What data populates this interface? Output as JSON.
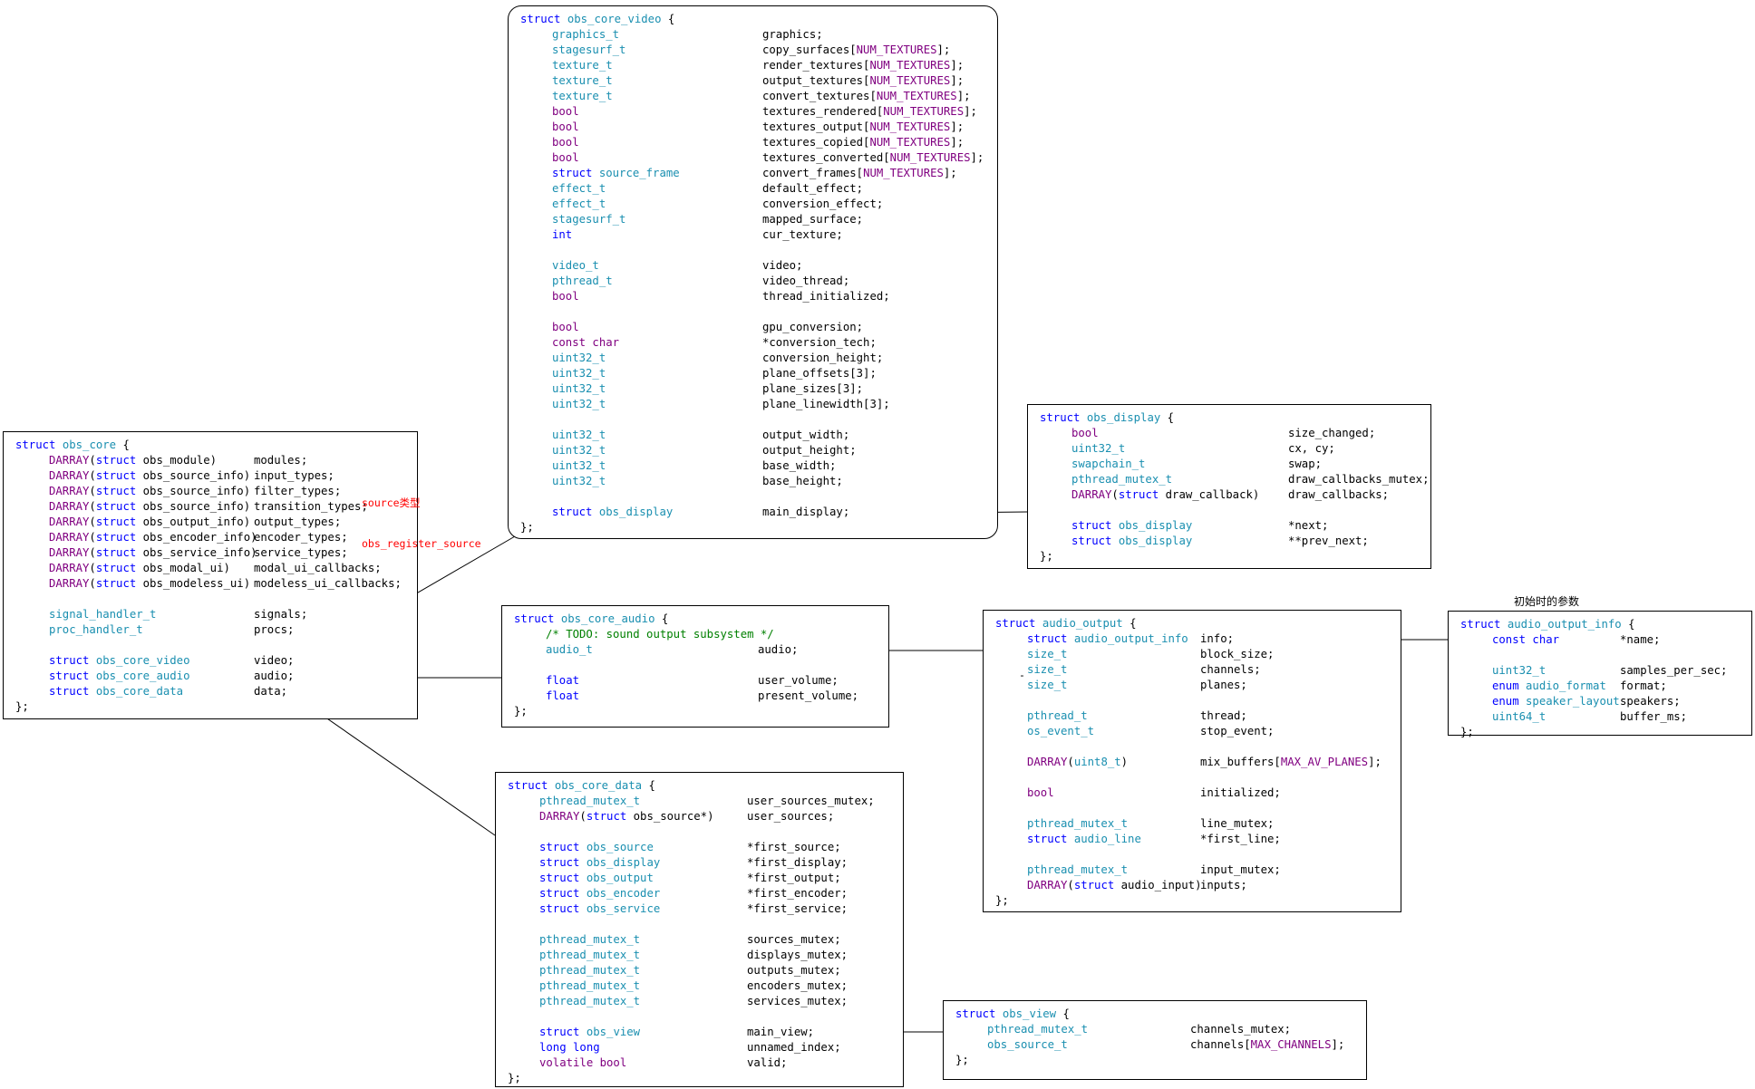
{
  "boxes": [
    {
      "id": "obs-core",
      "title": "obs_core",
      "lines": [
        [
          {
            "t": "DARRAY",
            "c": "mc"
          },
          {
            "t": "(",
            "c": "bk"
          },
          {
            "t": "struct",
            "c": "kw"
          },
          {
            "t": " obs_module)",
            "c": "bk"
          },
          {
            "n": "modules;"
          }
        ],
        [
          {
            "t": "DARRAY",
            "c": "mc"
          },
          {
            "t": "(",
            "c": "bk"
          },
          {
            "t": "struct",
            "c": "kw"
          },
          {
            "t": " obs_source_info)",
            "c": "bk"
          },
          {
            "n": "input_types;"
          }
        ],
        [
          {
            "t": "DARRAY",
            "c": "mc"
          },
          {
            "t": "(",
            "c": "bk"
          },
          {
            "t": "struct",
            "c": "kw"
          },
          {
            "t": " obs_source_info)",
            "c": "bk"
          },
          {
            "n": "filter_types;"
          }
        ],
        [
          {
            "t": "DARRAY",
            "c": "mc"
          },
          {
            "t": "(",
            "c": "bk"
          },
          {
            "t": "struct",
            "c": "kw"
          },
          {
            "t": " obs_source_info)",
            "c": "bk"
          },
          {
            "n": "transition_types;"
          }
        ],
        [
          {
            "t": "DARRAY",
            "c": "mc"
          },
          {
            "t": "(",
            "c": "bk"
          },
          {
            "t": "struct",
            "c": "kw"
          },
          {
            "t": " obs_output_info)",
            "c": "bk"
          },
          {
            "n": "output_types;"
          }
        ],
        [
          {
            "t": "DARRAY",
            "c": "mc"
          },
          {
            "t": "(",
            "c": "bk"
          },
          {
            "t": "struct",
            "c": "kw"
          },
          {
            "t": " obs_encoder_info)",
            "c": "bk"
          },
          {
            "n": "encoder_types;"
          }
        ],
        [
          {
            "t": "DARRAY",
            "c": "mc"
          },
          {
            "t": "(",
            "c": "bk"
          },
          {
            "t": "struct",
            "c": "kw"
          },
          {
            "t": " obs_service_info)",
            "c": "bk"
          },
          {
            "n": "service_types;"
          }
        ],
        [
          {
            "t": "DARRAY",
            "c": "mc"
          },
          {
            "t": "(",
            "c": "bk"
          },
          {
            "t": "struct",
            "c": "kw"
          },
          {
            "t": " obs_modal_ui)",
            "c": "bk"
          },
          {
            "n": "modal_ui_callbacks;"
          }
        ],
        [
          {
            "t": "DARRAY",
            "c": "mc"
          },
          {
            "t": "(",
            "c": "bk"
          },
          {
            "t": "struct",
            "c": "kw"
          },
          {
            "t": " obs_modeless_ui)",
            "c": "bk"
          },
          {
            "n": "modeless_ui_callbacks;"
          }
        ],
        [],
        [
          {
            "t": "signal_handler_t",
            "c": "tn"
          },
          {
            "n": "signals;"
          }
        ],
        [
          {
            "t": "proc_handler_t",
            "c": "tn"
          },
          {
            "n": "procs;"
          }
        ],
        [],
        [
          {
            "t": "struct",
            "c": "kw"
          },
          {
            "t": " obs_core_video",
            "c": "tn"
          },
          {
            "n": "video;"
          }
        ],
        [
          {
            "t": "struct",
            "c": "kw"
          },
          {
            "t": " obs_core_audio",
            "c": "tn"
          },
          {
            "n": "audio;"
          }
        ],
        [
          {
            "t": "struct",
            "c": "kw"
          },
          {
            "t": " obs_core_data",
            "c": "tn"
          },
          {
            "n": "data;"
          }
        ]
      ]
    },
    {
      "id": "obs-core-video",
      "title": "obs_core_video",
      "lines": [
        [
          {
            "t": "graphics_t",
            "c": "tn"
          },
          {
            "n": "graphics;"
          }
        ],
        [
          {
            "t": "stagesurf_t",
            "c": "tn"
          },
          {
            "n": "copy_surfaces[",
            "m": "NUM_TEXTURES",
            "e": "];"
          }
        ],
        [
          {
            "t": "texture_t",
            "c": "tn"
          },
          {
            "n": "render_textures[",
            "m": "NUM_TEXTURES",
            "e": "];"
          }
        ],
        [
          {
            "t": "texture_t",
            "c": "tn"
          },
          {
            "n": "output_textures[",
            "m": "NUM_TEXTURES",
            "e": "];"
          }
        ],
        [
          {
            "t": "texture_t",
            "c": "tn"
          },
          {
            "n": "convert_textures[",
            "m": "NUM_TEXTURES",
            "e": "];"
          }
        ],
        [
          {
            "t": "bool",
            "c": "mc"
          },
          {
            "n": "textures_rendered[",
            "m": "NUM_TEXTURES",
            "e": "];"
          }
        ],
        [
          {
            "t": "bool",
            "c": "mc"
          },
          {
            "n": "textures_output[",
            "m": "NUM_TEXTURES",
            "e": "];"
          }
        ],
        [
          {
            "t": "bool",
            "c": "mc"
          },
          {
            "n": "textures_copied[",
            "m": "NUM_TEXTURES",
            "e": "];"
          }
        ],
        [
          {
            "t": "bool",
            "c": "mc"
          },
          {
            "n": "textures_converted[",
            "m": "NUM_TEXTURES",
            "e": "];"
          }
        ],
        [
          {
            "t": "struct",
            "c": "kw"
          },
          {
            "t": " source_frame",
            "c": "tn"
          },
          {
            "n": "convert_frames[",
            "m": "NUM_TEXTURES",
            "e": "];"
          }
        ],
        [
          {
            "t": "effect_t",
            "c": "tn"
          },
          {
            "n": "default_effect;"
          }
        ],
        [
          {
            "t": "effect_t",
            "c": "tn"
          },
          {
            "n": "conversion_effect;"
          }
        ],
        [
          {
            "t": "stagesurf_t",
            "c": "tn"
          },
          {
            "n": "mapped_surface;"
          }
        ],
        [
          {
            "t": "int",
            "c": "kw"
          },
          {
            "n": "cur_texture;"
          }
        ],
        [],
        [
          {
            "t": "video_t",
            "c": "tn"
          },
          {
            "n": "video;"
          }
        ],
        [
          {
            "t": "pthread_t",
            "c": "tn"
          },
          {
            "n": "video_thread;"
          }
        ],
        [
          {
            "t": "bool",
            "c": "mc"
          },
          {
            "n": "thread_initialized;"
          }
        ],
        [],
        [
          {
            "t": "bool",
            "c": "mc"
          },
          {
            "n": "gpu_conversion;"
          }
        ],
        [
          {
            "t": "const char",
            "c": "mc"
          },
          {
            "n": "*conversion_tech;"
          }
        ],
        [
          {
            "t": "uint32_t",
            "c": "tn"
          },
          {
            "n": "conversion_height;"
          }
        ],
        [
          {
            "t": "uint32_t",
            "c": "tn"
          },
          {
            "n": "plane_offsets[3];"
          }
        ],
        [
          {
            "t": "uint32_t",
            "c": "tn"
          },
          {
            "n": "plane_sizes[3];"
          }
        ],
        [
          {
            "t": "uint32_t",
            "c": "tn"
          },
          {
            "n": "plane_linewidth[3];"
          }
        ],
        [],
        [
          {
            "t": "uint32_t",
            "c": "tn"
          },
          {
            "n": "output_width;"
          }
        ],
        [
          {
            "t": "uint32_t",
            "c": "tn"
          },
          {
            "n": "output_height;"
          }
        ],
        [
          {
            "t": "uint32_t",
            "c": "tn"
          },
          {
            "n": "base_width;"
          }
        ],
        [
          {
            "t": "uint32_t",
            "c": "tn"
          },
          {
            "n": "base_height;"
          }
        ],
        [],
        [
          {
            "t": "struct",
            "c": "kw"
          },
          {
            "t": " obs_display",
            "c": "tn"
          },
          {
            "n": "main_display;"
          }
        ]
      ]
    },
    {
      "id": "obs-display",
      "title": "obs_display",
      "lines": [
        [
          {
            "t": "bool",
            "c": "mc"
          },
          {
            "n": "size_changed;"
          }
        ],
        [
          {
            "t": "uint32_t",
            "c": "tn"
          },
          {
            "n": "cx, cy;"
          }
        ],
        [
          {
            "t": "swapchain_t",
            "c": "tn"
          },
          {
            "n": "swap;"
          }
        ],
        [
          {
            "t": "pthread_mutex_t",
            "c": "tn"
          },
          {
            "n": "draw_callbacks_mutex;"
          }
        ],
        [
          {
            "t": "DARRAY",
            "c": "mc"
          },
          {
            "t": "(",
            "c": "bk"
          },
          {
            "t": "struct",
            "c": "kw"
          },
          {
            "t": " draw_callback)",
            "c": "bk"
          },
          {
            "n": "draw_callbacks;"
          }
        ],
        [],
        [
          {
            "t": "struct",
            "c": "kw"
          },
          {
            "t": " obs_display",
            "c": "tn"
          },
          {
            "n": "*next;"
          }
        ],
        [
          {
            "t": "struct",
            "c": "kw"
          },
          {
            "t": " obs_display",
            "c": "tn"
          },
          {
            "n": "**prev_next;"
          }
        ]
      ]
    },
    {
      "id": "obs-core-audio",
      "title": "obs_core_audio",
      "lines": [
        [
          {
            "t": "/* TODO: sound output subsystem */",
            "c": "cm"
          }
        ],
        [
          {
            "t": "audio_t",
            "c": "tn"
          },
          {
            "n": "audio;"
          }
        ],
        [],
        [
          {
            "t": "float",
            "c": "kw"
          },
          {
            "n": "user_volume;"
          }
        ],
        [
          {
            "t": "float",
            "c": "kw"
          },
          {
            "n": "present_volume;"
          }
        ]
      ]
    },
    {
      "id": "audio-output",
      "title": "audio_output",
      "lines": [
        [
          {
            "t": "struct",
            "c": "kw"
          },
          {
            "t": " audio_output_info",
            "c": "tn"
          },
          {
            "n": "info;"
          }
        ],
        [
          {
            "t": "size_t",
            "c": "tn"
          },
          {
            "n": "block_size;"
          }
        ],
        [
          {
            "t": "size_t",
            "c": "tn"
          },
          {
            "n": "channels;"
          }
        ],
        [
          {
            "t": "size_t",
            "c": "tn"
          },
          {
            "n": "planes;"
          }
        ],
        [],
        [
          {
            "t": "pthread_t",
            "c": "tn"
          },
          {
            "n": "thread;"
          }
        ],
        [
          {
            "t": "os_event_t",
            "c": "tn"
          },
          {
            "n": "stop_event;"
          }
        ],
        [],
        [
          {
            "t": "DARRAY",
            "c": "mc"
          },
          {
            "t": "(",
            "c": "bk"
          },
          {
            "t": "uint8_t",
            "c": "tn"
          },
          {
            "t": ")",
            "c": "bk"
          },
          {
            "n": "mix_buffers[",
            "m": "MAX_AV_PLANES",
            "e": "];"
          }
        ],
        [],
        [
          {
            "t": "bool",
            "c": "mc"
          },
          {
            "n": "initialized;"
          }
        ],
        [],
        [
          {
            "t": "pthread_mutex_t",
            "c": "tn"
          },
          {
            "n": "line_mutex;"
          }
        ],
        [
          {
            "t": "struct",
            "c": "kw"
          },
          {
            "t": " audio_line",
            "c": "tn"
          },
          {
            "n": "*first_line;"
          }
        ],
        [],
        [
          {
            "t": "pthread_mutex_t",
            "c": "tn"
          },
          {
            "n": "input_mutex;"
          }
        ],
        [
          {
            "t": "DARRAY",
            "c": "mc"
          },
          {
            "t": "(",
            "c": "bk"
          },
          {
            "t": "struct",
            "c": "kw"
          },
          {
            "t": " audio_input)",
            "c": "bk"
          },
          {
            "n": "inputs;"
          }
        ]
      ]
    },
    {
      "id": "audio-output-info",
      "title": "audio_output_info",
      "lines": [
        [
          {
            "t": "const char",
            "c": "kw"
          },
          {
            "n": "*name;"
          }
        ],
        [],
        [
          {
            "t": "uint32_t",
            "c": "tn"
          },
          {
            "n": "samples_per_sec;"
          }
        ],
        [
          {
            "t": "enum",
            "c": "kw"
          },
          {
            "t": " audio_format",
            "c": "tn"
          },
          {
            "n": "format;"
          }
        ],
        [
          {
            "t": "enum",
            "c": "kw"
          },
          {
            "t": " speaker_layout",
            "c": "tn"
          },
          {
            "n": "speakers;"
          }
        ],
        [
          {
            "t": "uint64_t",
            "c": "tn"
          },
          {
            "n": "buffer_ms;"
          }
        ]
      ]
    },
    {
      "id": "obs-core-data",
      "title": "obs_core_data",
      "lines": [
        [
          {
            "t": "pthread_mutex_t",
            "c": "tn"
          },
          {
            "n": "user_sources_mutex;"
          }
        ],
        [
          {
            "t": "DARRAY",
            "c": "mc"
          },
          {
            "t": "(",
            "c": "bk"
          },
          {
            "t": "struct",
            "c": "kw"
          },
          {
            "t": " obs_source*)",
            "c": "bk"
          },
          {
            "n": "user_sources;"
          }
        ],
        [],
        [
          {
            "t": "struct",
            "c": "kw"
          },
          {
            "t": " obs_source",
            "c": "tn"
          },
          {
            "n": "*first_source;"
          }
        ],
        [
          {
            "t": "struct",
            "c": "kw"
          },
          {
            "t": " obs_display",
            "c": "tn"
          },
          {
            "n": "*first_display;"
          }
        ],
        [
          {
            "t": "struct",
            "c": "kw"
          },
          {
            "t": " obs_output",
            "c": "tn"
          },
          {
            "n": "*first_output;"
          }
        ],
        [
          {
            "t": "struct",
            "c": "kw"
          },
          {
            "t": " obs_encoder",
            "c": "tn"
          },
          {
            "n": "*first_encoder;"
          }
        ],
        [
          {
            "t": "struct",
            "c": "kw"
          },
          {
            "t": " obs_service",
            "c": "tn"
          },
          {
            "n": "*first_service;"
          }
        ],
        [],
        [
          {
            "t": "pthread_mutex_t",
            "c": "tn"
          },
          {
            "n": "sources_mutex;"
          }
        ],
        [
          {
            "t": "pthread_mutex_t",
            "c": "tn"
          },
          {
            "n": "displays_mutex;"
          }
        ],
        [
          {
            "t": "pthread_mutex_t",
            "c": "tn"
          },
          {
            "n": "outputs_mutex;"
          }
        ],
        [
          {
            "t": "pthread_mutex_t",
            "c": "tn"
          },
          {
            "n": "encoders_mutex;"
          }
        ],
        [
          {
            "t": "pthread_mutex_t",
            "c": "tn"
          },
          {
            "n": "services_mutex;"
          }
        ],
        [],
        [
          {
            "t": "struct",
            "c": "kw"
          },
          {
            "t": " obs_view",
            "c": "tn"
          },
          {
            "n": "main_view;"
          }
        ],
        [
          {
            "t": "long long",
            "c": "kw"
          },
          {
            "n": "unnamed_index;"
          }
        ],
        [
          {
            "t": "volatile bool",
            "c": "mc"
          },
          {
            "n": "valid;"
          }
        ]
      ]
    },
    {
      "id": "obs-view",
      "title": "obs_view",
      "lines": [
        [
          {
            "t": "pthread_mutex_t",
            "c": "tn"
          },
          {
            "n": "channels_mutex;"
          }
        ],
        [
          {
            "t": "obs_source_t",
            "c": "tn"
          },
          {
            "n": "channels[",
            "m": "MAX_CHANNELS",
            "e": "];"
          }
        ]
      ]
    }
  ],
  "labels": {
    "struct_kw": "struct",
    "open_brace": " {",
    "close_brace": "};",
    "source_note_1": "source类型",
    "source_note_2": "obs_register_source",
    "init_params": "初始时的参数",
    "stray_mark": "-"
  },
  "colors": {
    "keyword": "#0000ff",
    "type_name": "#1a8fb0",
    "macro": "#800080",
    "comment": "#008000",
    "highlight": "#ff0000"
  }
}
